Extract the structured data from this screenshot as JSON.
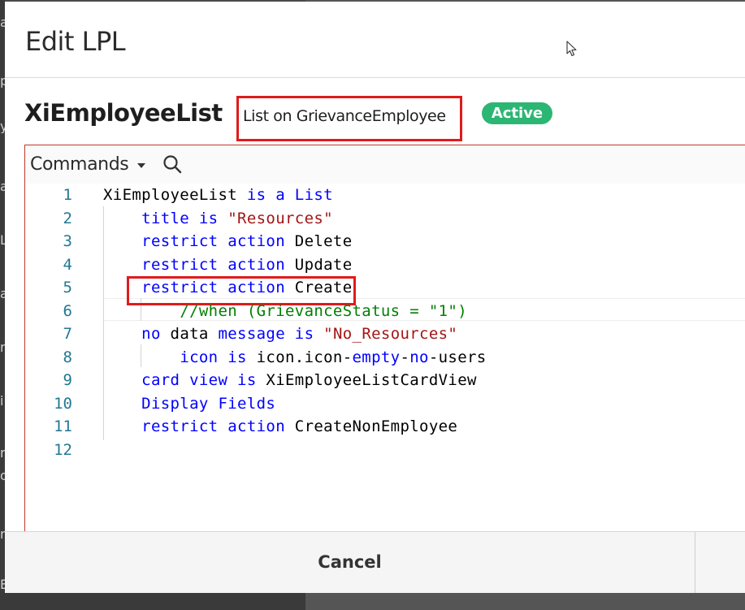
{
  "backdrop": {
    "letters": [
      "a",
      "p",
      "y",
      "a",
      "L",
      "a",
      "r",
      "i",
      "r",
      "o",
      "m",
      "E"
    ]
  },
  "dialog": {
    "title": "Edit LPL"
  },
  "entity": {
    "name": "XiEmployeeList",
    "subtitle": "List on GrievanceEmployee",
    "status": "Active",
    "status_color": "#2bb673"
  },
  "toolbar": {
    "commands_label": "Commands"
  },
  "editor": {
    "lines": [
      {
        "number": "1",
        "tokens": [
          [
            "XiEmployeeList ",
            "plain"
          ],
          [
            "is a List",
            "kw"
          ]
        ]
      },
      {
        "number": "2",
        "tokens": [
          [
            "    ",
            "plain"
          ],
          [
            "title is ",
            "kw"
          ],
          [
            "\"Resources\"",
            "str"
          ]
        ]
      },
      {
        "number": "3",
        "tokens": [
          [
            "    ",
            "plain"
          ],
          [
            "restrict action ",
            "kw"
          ],
          [
            "Delete",
            "plain"
          ]
        ]
      },
      {
        "number": "4",
        "tokens": [
          [
            "    ",
            "plain"
          ],
          [
            "restrict action ",
            "kw"
          ],
          [
            "Update",
            "plain"
          ]
        ]
      },
      {
        "number": "5",
        "tokens": [
          [
            "    ",
            "plain"
          ],
          [
            "restrict action ",
            "kw"
          ],
          [
            "Create",
            "plain"
          ]
        ]
      },
      {
        "number": "6",
        "tokens": [
          [
            "        ",
            "plain"
          ],
          [
            "//when (GrievanceStatus = \"1\")",
            "cmt"
          ]
        ]
      },
      {
        "number": "7",
        "tokens": [
          [
            "    ",
            "plain"
          ],
          [
            "no ",
            "kw"
          ],
          [
            "data ",
            "plain"
          ],
          [
            "message is ",
            "kw"
          ],
          [
            "\"No_Resources\"",
            "str"
          ]
        ]
      },
      {
        "number": "8",
        "tokens": [
          [
            "        ",
            "plain"
          ],
          [
            "icon is ",
            "kw"
          ],
          [
            "icon.icon-",
            "plain"
          ],
          [
            "empty",
            "kw"
          ],
          [
            "-",
            "plain"
          ],
          [
            "no",
            "kw"
          ],
          [
            "-users",
            "plain"
          ]
        ]
      },
      {
        "number": "9",
        "tokens": [
          [
            "    ",
            "plain"
          ],
          [
            "card view is ",
            "kw"
          ],
          [
            "XiEmployeeListCardView",
            "plain"
          ]
        ]
      },
      {
        "number": "10",
        "tokens": [
          [
            "    ",
            "plain"
          ],
          [
            "Display Fields",
            "kw"
          ]
        ]
      },
      {
        "number": "11",
        "tokens": [
          [
            "    ",
            "plain"
          ],
          [
            "restrict action ",
            "kw"
          ],
          [
            "CreateNonEmployee",
            "plain"
          ]
        ]
      },
      {
        "number": "12",
        "tokens": []
      }
    ],
    "colors": {
      "keyword": "#0000ff",
      "string": "#a31515",
      "comment": "#008000",
      "line_number": "#237893"
    }
  },
  "footer": {
    "cancel_label": "Cancel"
  }
}
